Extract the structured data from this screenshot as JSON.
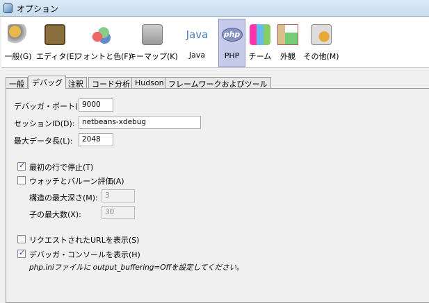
{
  "window": {
    "title": "オプション"
  },
  "toolbar": {
    "items": [
      {
        "label": "一般(G)",
        "icon": "wrench-gear-icon"
      },
      {
        "label": "エディタ(E)",
        "icon": "book-pencil-icon"
      },
      {
        "label": "フォントと色(F)",
        "icon": "font-color-icon"
      },
      {
        "label": "キーマップ(K)",
        "icon": "keyboard-icon"
      },
      {
        "label": "Java",
        "icon": "java-icon"
      },
      {
        "label": "PHP",
        "icon": "php-icon",
        "selected": true
      },
      {
        "label": "チーム",
        "icon": "team-cubes-icon"
      },
      {
        "label": "外観",
        "icon": "appearance-icon"
      },
      {
        "label": "その他(M)",
        "icon": "misc-gear-icon"
      }
    ],
    "java_logo_text": "Java",
    "php_logo_text": "php"
  },
  "tabs": [
    "一般",
    "デバッグ",
    "注釈",
    "コード分析",
    "Hudson",
    "フレームワークおよびツール"
  ],
  "form": {
    "port_label": "デバッガ・ポート(G):",
    "port_value": "9000",
    "session_label": "セッションID(D):",
    "session_value": "netbeans-xdebug",
    "maxlen_label": "最大データ長(L):",
    "maxlen_value": "2048",
    "stop_first_line": "最初の行で停止(T)",
    "watch_balloon": "ウォッチとバルーン評価(A)",
    "max_depth_label": "構造の最大深さ(M):",
    "max_depth_value": "3",
    "max_children_label": "子の最大数(X):",
    "max_children_value": "30",
    "show_url": "リクエストされたURLを表示(S)",
    "show_console": "デバッガ・コンソールを表示(H)",
    "note": "php.iniファイルに output_buffering=Offを設定してください。"
  }
}
